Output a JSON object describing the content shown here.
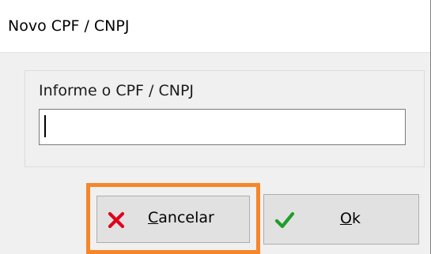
{
  "window": {
    "title": "Novo CPF / CNPJ"
  },
  "form": {
    "label": "Informe o CPF / CNPJ",
    "input_value": ""
  },
  "buttons": {
    "cancel": {
      "accel": "C",
      "rest": "ancelar",
      "icon": "close-icon",
      "icon_color": "#e0001b"
    },
    "ok": {
      "accel": "O",
      "rest": "k",
      "icon": "check-icon",
      "icon_color": "#1e9e2a"
    }
  },
  "colors": {
    "focus_outline": "#f5862a",
    "dialog_bg": "#f0f0f0",
    "button_bg": "#e1e1e1"
  }
}
